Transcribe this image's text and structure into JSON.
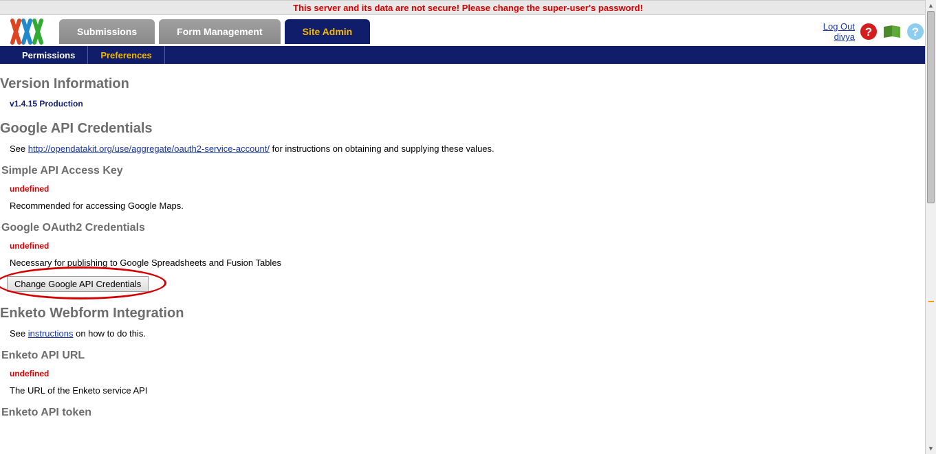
{
  "warning": "This server and its data are not secure! Please change the super-user's password!",
  "header": {
    "tabs": [
      {
        "label": "Submissions",
        "active": false
      },
      {
        "label": "Form Management",
        "active": false
      },
      {
        "label": "Site Admin",
        "active": true
      }
    ],
    "logout": "Log Out",
    "username": "divya"
  },
  "subnav": [
    {
      "label": "Permissions",
      "active": false
    },
    {
      "label": "Preferences",
      "active": true
    }
  ],
  "sections": {
    "version": {
      "heading": "Version Information",
      "value": "v1.4.15 Production"
    },
    "google": {
      "heading": "Google API Credentials",
      "intro_before": "See ",
      "intro_link": "http://opendatakit.org/use/aggregate/oauth2-service-account/",
      "intro_after": " for instructions on obtaining and supplying these values.",
      "simple": {
        "heading": "Simple API Access Key",
        "value": "undefined",
        "desc": "Recommended for accessing Google Maps."
      },
      "oauth": {
        "heading": "Google OAuth2 Credentials",
        "value": "undefined",
        "desc": "Necessary for publishing to Google Spreadsheets and Fusion Tables"
      },
      "button": "Change Google API Credentials"
    },
    "enketo": {
      "heading": "Enketo Webform Integration",
      "intro_before": "See ",
      "intro_link": "instructions",
      "intro_after": " on how to do this.",
      "url": {
        "heading": "Enketo API URL",
        "value": "undefined",
        "desc": "The URL of the Enketo service API"
      },
      "token": {
        "heading": "Enketo API token"
      }
    }
  }
}
